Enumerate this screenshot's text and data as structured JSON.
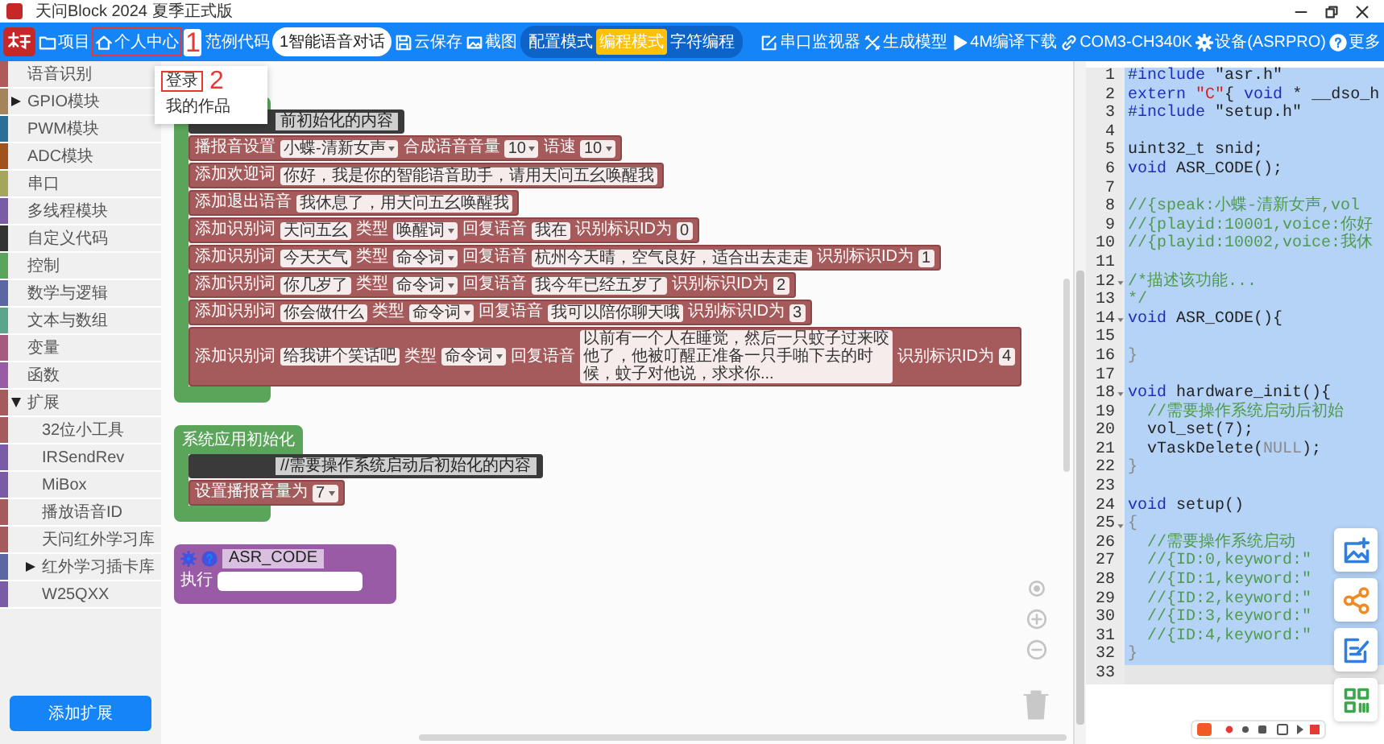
{
  "window": {
    "title": "天问Block 2024 夏季正式版"
  },
  "toolbar": {
    "items": [
      {
        "label": "项目",
        "highlighted": false
      },
      {
        "label": "个人中心",
        "highlighted": true,
        "annotation": "1",
        "menu": [
          {
            "label": "登录",
            "highlighted": true,
            "annotation": "2"
          },
          {
            "label": "我的作品",
            "highlighted": false
          }
        ]
      },
      {
        "label": "范例代码",
        "highlighted": false
      }
    ],
    "project_pill": "1智能语音对话",
    "actions": [
      {
        "label": "云保存"
      },
      {
        "label": "截图"
      }
    ],
    "modes": [
      {
        "label": "配置模式",
        "selected": false
      },
      {
        "label": "编程模式",
        "selected": true
      },
      {
        "label": "字符编程",
        "selected": false
      }
    ],
    "right": [
      {
        "label": "串口监视器"
      },
      {
        "label": "生成模型"
      },
      {
        "label": "4M编译下载"
      },
      {
        "label": "COM3-CH340K"
      },
      {
        "label": "设备(ASRPRO)"
      },
      {
        "label": "更多"
      }
    ]
  },
  "sidebar": {
    "categories": [
      {
        "label": "语音识别",
        "color": "#b05a5a"
      },
      {
        "label": "GPIO模块",
        "color": "#a5845b",
        "expanded": false
      },
      {
        "label": "PWM模块",
        "color": "#2a6f97"
      },
      {
        "label": "ADC模块",
        "color": "#a0521f"
      },
      {
        "label": "串口",
        "color": "#a5a55b"
      },
      {
        "label": "多线程模块",
        "color": "#7a5ba5"
      },
      {
        "label": "自定义代码",
        "color": "#333333"
      },
      {
        "label": "控制",
        "color": "#5ba55b"
      },
      {
        "label": "数学与逻辑",
        "color": "#5b67a5"
      },
      {
        "label": "文本与数组",
        "color": "#5ba58c"
      },
      {
        "label": "变量",
        "color": "#a55b80"
      },
      {
        "label": "函数",
        "color": "#995ba5"
      },
      {
        "label": "扩展",
        "color": "#a55b5b",
        "expanded": true,
        "children": [
          {
            "label": "32位小工具",
            "color": "#a55b5b"
          },
          {
            "label": "IRSendRev",
            "color": "#7a5ba5"
          },
          {
            "label": "MiBox",
            "color": "#7a5ba5"
          },
          {
            "label": "播放语音ID",
            "color": "#a55b5b"
          },
          {
            "label": "天问红外学习库",
            "color": "#a55b5b"
          },
          {
            "label": "红外学习插卡库",
            "color": "#5b67a5",
            "expanded": false
          },
          {
            "label": "W25QXX",
            "color": "#7a5ba5"
          }
        ]
      }
    ],
    "add_button": "添加扩展"
  },
  "workspace": {
    "blocks": [
      {
        "kind": "c-block",
        "comment": "前初始化的内容",
        "rows": [
          {
            "parts": [
              {
                "kind": "label",
                "text": "播报音设置"
              },
              {
                "kind": "dropdown",
                "text": "小蝶-清新女声"
              },
              {
                "kind": "label",
                "text": "合成语音音量"
              },
              {
                "kind": "dropdown",
                "text": "10"
              },
              {
                "kind": "label",
                "text": "语速"
              },
              {
                "kind": "dropdown",
                "text": "10"
              }
            ]
          },
          {
            "parts": [
              {
                "kind": "label",
                "text": "添加欢迎词"
              },
              {
                "kind": "field",
                "text": "你好，我是你的智能语音助手，请用天问五幺唤醒我"
              }
            ]
          },
          {
            "parts": [
              {
                "kind": "label",
                "text": "添加退出语音"
              },
              {
                "kind": "field",
                "text": "我休息了，用天问五幺唤醒我"
              }
            ]
          },
          {
            "parts": [
              {
                "kind": "label",
                "text": "添加识别词"
              },
              {
                "kind": "field",
                "text": "天问五幺"
              },
              {
                "kind": "label",
                "text": "类型"
              },
              {
                "kind": "dropdown",
                "text": "唤醒词"
              },
              {
                "kind": "label",
                "text": "回复语音"
              },
              {
                "kind": "field",
                "text": "我在"
              },
              {
                "kind": "label",
                "text": "识别标识ID为"
              },
              {
                "kind": "field",
                "text": "0"
              }
            ]
          },
          {
            "parts": [
              {
                "kind": "label",
                "text": "添加识别词"
              },
              {
                "kind": "field",
                "text": "今天天气"
              },
              {
                "kind": "label",
                "text": "类型"
              },
              {
                "kind": "dropdown",
                "text": "命令词"
              },
              {
                "kind": "label",
                "text": "回复语音"
              },
              {
                "kind": "field",
                "text": "杭州今天晴，空气良好，适合出去走走"
              },
              {
                "kind": "label",
                "text": "识别标识ID为"
              },
              {
                "kind": "field",
                "text": "1"
              }
            ]
          },
          {
            "parts": [
              {
                "kind": "label",
                "text": "添加识别词"
              },
              {
                "kind": "field",
                "text": "你几岁了"
              },
              {
                "kind": "label",
                "text": "类型"
              },
              {
                "kind": "dropdown",
                "text": "命令词"
              },
              {
                "kind": "label",
                "text": "回复语音"
              },
              {
                "kind": "field",
                "text": "我今年已经五岁了"
              },
              {
                "kind": "label",
                "text": "识别标识ID为"
              },
              {
                "kind": "field",
                "text": "2"
              }
            ]
          },
          {
            "parts": [
              {
                "kind": "label",
                "text": "添加识别词"
              },
              {
                "kind": "field",
                "text": "你会做什么"
              },
              {
                "kind": "label",
                "text": "类型"
              },
              {
                "kind": "dropdown",
                "text": "命令词"
              },
              {
                "kind": "label",
                "text": "回复语音"
              },
              {
                "kind": "field",
                "text": "我可以陪你聊天哦"
              },
              {
                "kind": "label",
                "text": "识别标识ID为"
              },
              {
                "kind": "field",
                "text": "3"
              }
            ]
          },
          {
            "parts": [
              {
                "kind": "label",
                "text": "添加识别词"
              },
              {
                "kind": "field",
                "text": "给我讲个笑话吧"
              },
              {
                "kind": "label",
                "text": "类型"
              },
              {
                "kind": "dropdown",
                "text": "命令词"
              },
              {
                "kind": "label",
                "text": "回复语音"
              },
              {
                "kind": "field",
                "text": "以前有一个人在睡觉，然后一只蚊子过来咬他了，他被叮醒正准备一只手啪下去的时候，蚊子对他说，求求你..."
              },
              {
                "kind": "label",
                "text": "识别标识ID为"
              },
              {
                "kind": "field",
                "text": "4"
              }
            ]
          }
        ]
      },
      {
        "kind": "c-block",
        "hat": "系统应用初始化",
        "comment": "//需要操作系统启动后初始化的内容",
        "rows": [
          {
            "parts": [
              {
                "kind": "label",
                "text": "设置播报音量为"
              },
              {
                "kind": "dropdown",
                "text": "7"
              }
            ]
          }
        ]
      },
      {
        "kind": "function",
        "name": "ASR_CODE",
        "body_label": "执行"
      }
    ]
  },
  "code": {
    "lines": [
      {
        "n": "1",
        "selected": true,
        "fold": false,
        "tokens": [
          {
            "kind": "kw",
            "text": "#include"
          },
          {
            "kind": "plain",
            "text": " \"asr.h\""
          }
        ]
      },
      {
        "n": "2",
        "selected": true,
        "fold": false,
        "tokens": [
          {
            "kind": "kw",
            "text": "extern"
          },
          {
            "kind": "red",
            "text": " \"C\""
          },
          {
            "kind": "plain",
            "text": "{ "
          },
          {
            "kind": "kw",
            "text": "void"
          },
          {
            "kind": "plain",
            "text": " * __dso_h"
          }
        ]
      },
      {
        "n": "3",
        "selected": true,
        "fold": false,
        "tokens": [
          {
            "kind": "kw",
            "text": "#include"
          },
          {
            "kind": "plain",
            "text": " \"setup.h\""
          }
        ]
      },
      {
        "n": "4",
        "selected": true,
        "fold": false
      },
      {
        "n": "5",
        "selected": true,
        "fold": false,
        "tokens": [
          {
            "kind": "plain",
            "text": "uint32_t snid;"
          }
        ]
      },
      {
        "n": "6",
        "selected": true,
        "fold": false,
        "tokens": [
          {
            "kind": "kw",
            "text": "void"
          },
          {
            "kind": "plain",
            "text": " ASR_CODE();"
          }
        ]
      },
      {
        "n": "7",
        "selected": true,
        "fold": false
      },
      {
        "n": "8",
        "selected": true,
        "fold": false,
        "tokens": [
          {
            "kind": "com",
            "text": "//{speak:小蝶-清新女声,vol"
          }
        ]
      },
      {
        "n": "9",
        "selected": true,
        "fold": false,
        "tokens": [
          {
            "kind": "com",
            "text": "//{playid:10001,voice:你好"
          }
        ]
      },
      {
        "n": "10",
        "selected": true,
        "fold": false,
        "tokens": [
          {
            "kind": "com",
            "text": "//{playid:10002,voice:我休"
          }
        ]
      },
      {
        "n": "11",
        "selected": true,
        "fold": false
      },
      {
        "n": "12",
        "selected": true,
        "fold": true,
        "tokens": [
          {
            "kind": "com",
            "text": "/*描述该功能..."
          }
        ]
      },
      {
        "n": "13",
        "selected": true,
        "fold": false,
        "tokens": [
          {
            "kind": "com",
            "text": "*/"
          }
        ]
      },
      {
        "n": "14",
        "selected": true,
        "fold": true,
        "tokens": [
          {
            "kind": "kw",
            "text": "void"
          },
          {
            "kind": "plain",
            "text": " ASR_CODE(){"
          }
        ]
      },
      {
        "n": "15",
        "selected": true,
        "fold": false
      },
      {
        "n": "16",
        "selected": true,
        "fold": false,
        "tokens": [
          {
            "kind": "dim",
            "text": "}"
          }
        ]
      },
      {
        "n": "17",
        "selected": true,
        "fold": false
      },
      {
        "n": "18",
        "selected": true,
        "fold": true,
        "tokens": [
          {
            "kind": "kw",
            "text": "void"
          },
          {
            "kind": "plain",
            "text": " hardware_init(){"
          }
        ]
      },
      {
        "n": "19",
        "selected": true,
        "fold": false,
        "tokens": [
          {
            "kind": "com",
            "text": "  //需要操作系统启动后初始"
          }
        ]
      },
      {
        "n": "20",
        "selected": true,
        "fold": false,
        "tokens": [
          {
            "kind": "plain",
            "text": "  vol_set(7);"
          }
        ]
      },
      {
        "n": "21",
        "selected": true,
        "fold": false,
        "tokens": [
          {
            "kind": "plain",
            "text": "  vTaskDelete("
          },
          {
            "kind": "dim",
            "text": "NULL"
          },
          {
            "kind": "plain",
            "text": ");"
          }
        ]
      },
      {
        "n": "22",
        "selected": true,
        "fold": false,
        "tokens": [
          {
            "kind": "dim",
            "text": "}"
          }
        ]
      },
      {
        "n": "23",
        "selected": true,
        "fold": false
      },
      {
        "n": "24",
        "selected": true,
        "fold": false,
        "tokens": [
          {
            "kind": "kw",
            "text": "void"
          },
          {
            "kind": "plain",
            "text": " setup()"
          }
        ]
      },
      {
        "n": "25",
        "selected": true,
        "fold": true,
        "tokens": [
          {
            "kind": "dim",
            "text": "{"
          }
        ]
      },
      {
        "n": "26",
        "selected": true,
        "fold": false,
        "tokens": [
          {
            "kind": "com",
            "text": "  //需要操作系统启动"
          }
        ]
      },
      {
        "n": "27",
        "selected": true,
        "fold": false,
        "tokens": [
          {
            "kind": "com",
            "text": "  //{ID:0,keyword:\""
          }
        ]
      },
      {
        "n": "28",
        "selected": true,
        "fold": false,
        "tokens": [
          {
            "kind": "com",
            "text": "  //{ID:1,keyword:\""
          }
        ]
      },
      {
        "n": "29",
        "selected": true,
        "fold": false,
        "tokens": [
          {
            "kind": "com",
            "text": "  //{ID:2,keyword:\""
          }
        ]
      },
      {
        "n": "30",
        "selected": true,
        "fold": false,
        "tokens": [
          {
            "kind": "com",
            "text": "  //{ID:3,keyword:\""
          }
        ]
      },
      {
        "n": "31",
        "selected": true,
        "fold": false,
        "tokens": [
          {
            "kind": "com",
            "text": "  //{ID:4,keyword:\""
          }
        ]
      },
      {
        "n": "32",
        "selected": true,
        "fold": false,
        "tokens": [
          {
            "kind": "dim",
            "text": "}"
          }
        ]
      },
      {
        "n": "33",
        "selected": false,
        "fold": false
      }
    ]
  }
}
